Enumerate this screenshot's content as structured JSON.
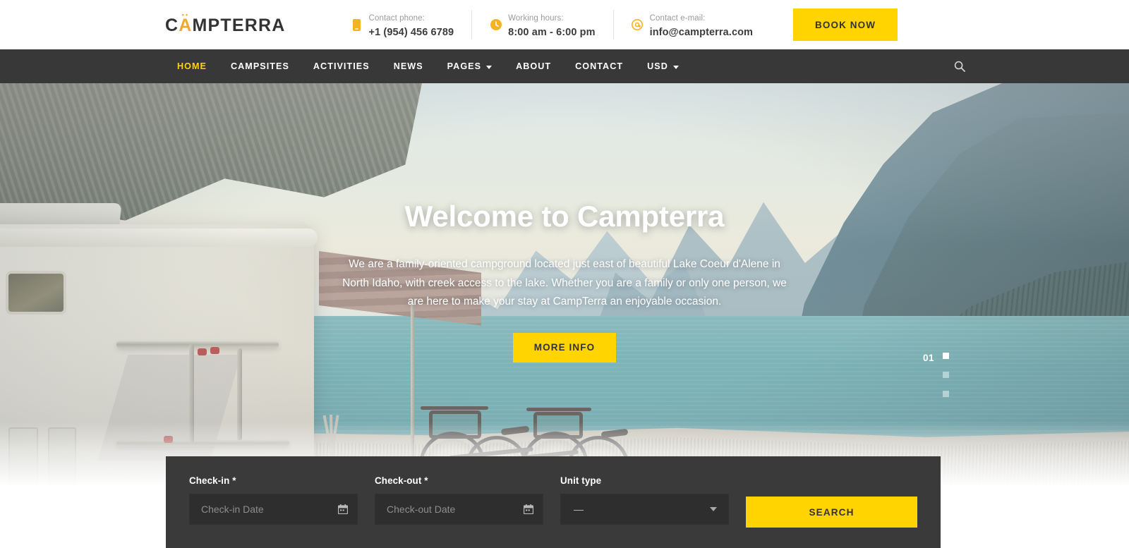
{
  "brand": {
    "name_before": "C",
    "name_accent": "A",
    "name_after": "MPTERRA",
    "accent_color": "#f0a830"
  },
  "topbar": {
    "contacts": [
      {
        "icon": "phone-icon",
        "label": "Contact phone:",
        "value": "+1 (954) 456 6789"
      },
      {
        "icon": "clock-icon",
        "label": "Working hours:",
        "value": "8:00 am - 6:00 pm"
      },
      {
        "icon": "at-email-icon",
        "label": "Contact e-mail:",
        "value": "info@campterra.com"
      }
    ],
    "book_now_label": "BOOK NOW",
    "accent_color": "#ffd400"
  },
  "nav": {
    "items": [
      {
        "label": "HOME",
        "active": true,
        "has_caret": false
      },
      {
        "label": "CAMPSITES",
        "active": false,
        "has_caret": false
      },
      {
        "label": "ACTIVITIES",
        "active": false,
        "has_caret": false
      },
      {
        "label": "NEWS",
        "active": false,
        "has_caret": false
      },
      {
        "label": "PAGES",
        "active": false,
        "has_caret": true
      },
      {
        "label": "ABOUT",
        "active": false,
        "has_caret": false
      },
      {
        "label": "CONTACT",
        "active": false,
        "has_caret": false
      },
      {
        "label": "USD",
        "active": false,
        "has_caret": true
      }
    ],
    "background": "#383838",
    "active_color": "#ffd400",
    "search_icon": "search-icon"
  },
  "hero": {
    "title": "Welcome to Campterra",
    "paragraph": "We are a family-oriented campground located just east of beautiful Lake Coeur d'Alene in North Idaho, with creek access to the lake. Whether you are a family or only one person, we are here to make your stay at CampTerra an enjoyable occasion.",
    "cta_label": "MORE INFO",
    "slide_number": "01",
    "slide_count": 3,
    "active_slide": 1
  },
  "booking": {
    "checkin": {
      "label": "Check-in",
      "required_mark": "*",
      "placeholder": "Check-in Date",
      "value": "",
      "icon": "calendar-icon"
    },
    "checkout": {
      "label": "Check-out",
      "required_mark": "*",
      "placeholder": "Check-out Date",
      "value": "",
      "icon": "calendar-icon"
    },
    "unit_type": {
      "label": "Unit type",
      "selected": "—",
      "icon": "chevron-down-icon"
    },
    "search_label": "SEARCH",
    "panel_background": "#3a3a3a"
  }
}
